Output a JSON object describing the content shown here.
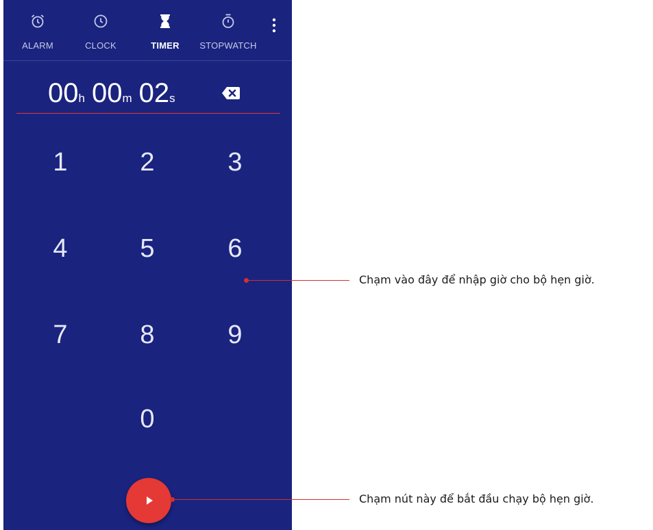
{
  "tabs": [
    {
      "label": "ALARM",
      "icon": "alarm-icon",
      "active": false
    },
    {
      "label": "CLOCK",
      "icon": "clock-icon",
      "active": false
    },
    {
      "label": "TIMER",
      "icon": "hourglass-icon",
      "active": true
    },
    {
      "label": "STOPWATCH",
      "icon": "stopwatch-icon",
      "active": false
    }
  ],
  "timer": {
    "hours": "00",
    "hours_unit": "h",
    "minutes": "00",
    "minutes_unit": "m",
    "seconds": "02",
    "seconds_unit": "s"
  },
  "keypad": [
    "1",
    "2",
    "3",
    "4",
    "5",
    "6",
    "7",
    "8",
    "9",
    "0"
  ],
  "callouts": {
    "keypad": "Chạm vào đây để nhập giờ cho bộ hẹn giờ.",
    "start": "Chạm nút này để bắt đầu chạy  bộ hẹn giờ."
  },
  "colors": {
    "background": "#1a237e",
    "accent": "#e53935",
    "callout": "#d32f2f"
  }
}
